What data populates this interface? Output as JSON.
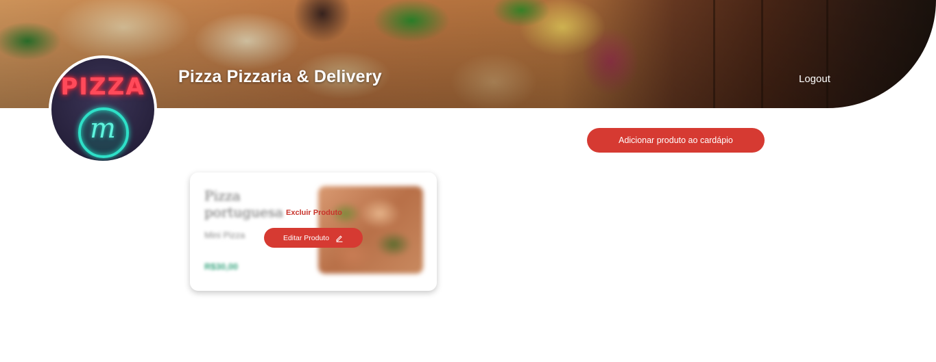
{
  "header": {
    "title": "Pizza Pizzaria & Delivery",
    "logout_label": "Logout"
  },
  "avatar": {
    "sign_text": "PIZZA",
    "emblem_letter": "m"
  },
  "actions": {
    "add_product_label": "Adicionar produto ao cardápio"
  },
  "products": [
    {
      "name": "Pizza portuguesa",
      "description": "Mini Pizza",
      "price": "R$30,00",
      "delete_label": "Excluir Produto",
      "edit_label": "Editar Produto",
      "edit_icon": "pencil-icon"
    }
  ],
  "colors": {
    "accent": "#d63a32",
    "price": "#3aa680"
  }
}
